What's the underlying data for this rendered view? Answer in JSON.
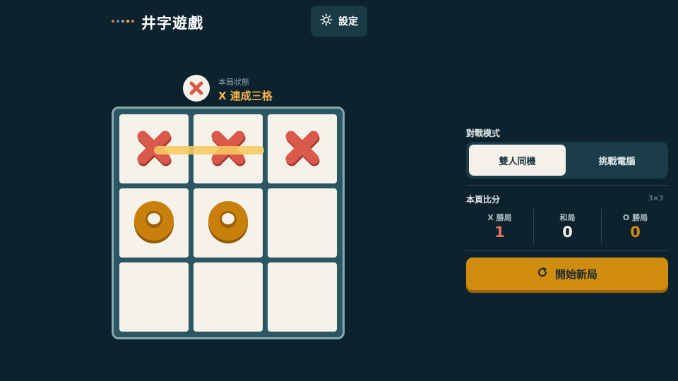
{
  "header": {
    "title": "井字遊戲",
    "settings_label": "設定",
    "dots_colors": [
      "#e07a5f",
      "#4f8fa8",
      "#9aa8ad",
      "#f2b24a",
      "#e07a5f"
    ]
  },
  "status": {
    "caption": "本局狀態",
    "text": "X 連成三格",
    "icon": "x-mark-icon"
  },
  "board": {
    "size": "3×3",
    "cells": [
      "X",
      "X",
      "X",
      "O",
      "O",
      "",
      "",
      "",
      ""
    ],
    "winning_line": [
      0,
      1,
      2
    ]
  },
  "mode": {
    "label": "對戰模式",
    "options": [
      {
        "label": "雙人同機",
        "active": true
      },
      {
        "label": "挑戰電腦",
        "active": false
      }
    ]
  },
  "score": {
    "label": "本頁比分",
    "grid": "3×3",
    "items": [
      {
        "label": "X 勝局",
        "value": "1",
        "color": "#e07266"
      },
      {
        "label": "和局",
        "value": "0",
        "color": "#f3f1ea"
      },
      {
        "label": "O 勝局",
        "value": "0",
        "color": "#d08c0e"
      }
    ]
  },
  "new_game": {
    "label": "開始新局",
    "icon": "restart-icon"
  },
  "colors": {
    "background": "#0c222d",
    "x_mark": "#d9594a",
    "o_mark": "#c97f0b",
    "accent": "#f2b24a",
    "button": "#d08c0e"
  }
}
